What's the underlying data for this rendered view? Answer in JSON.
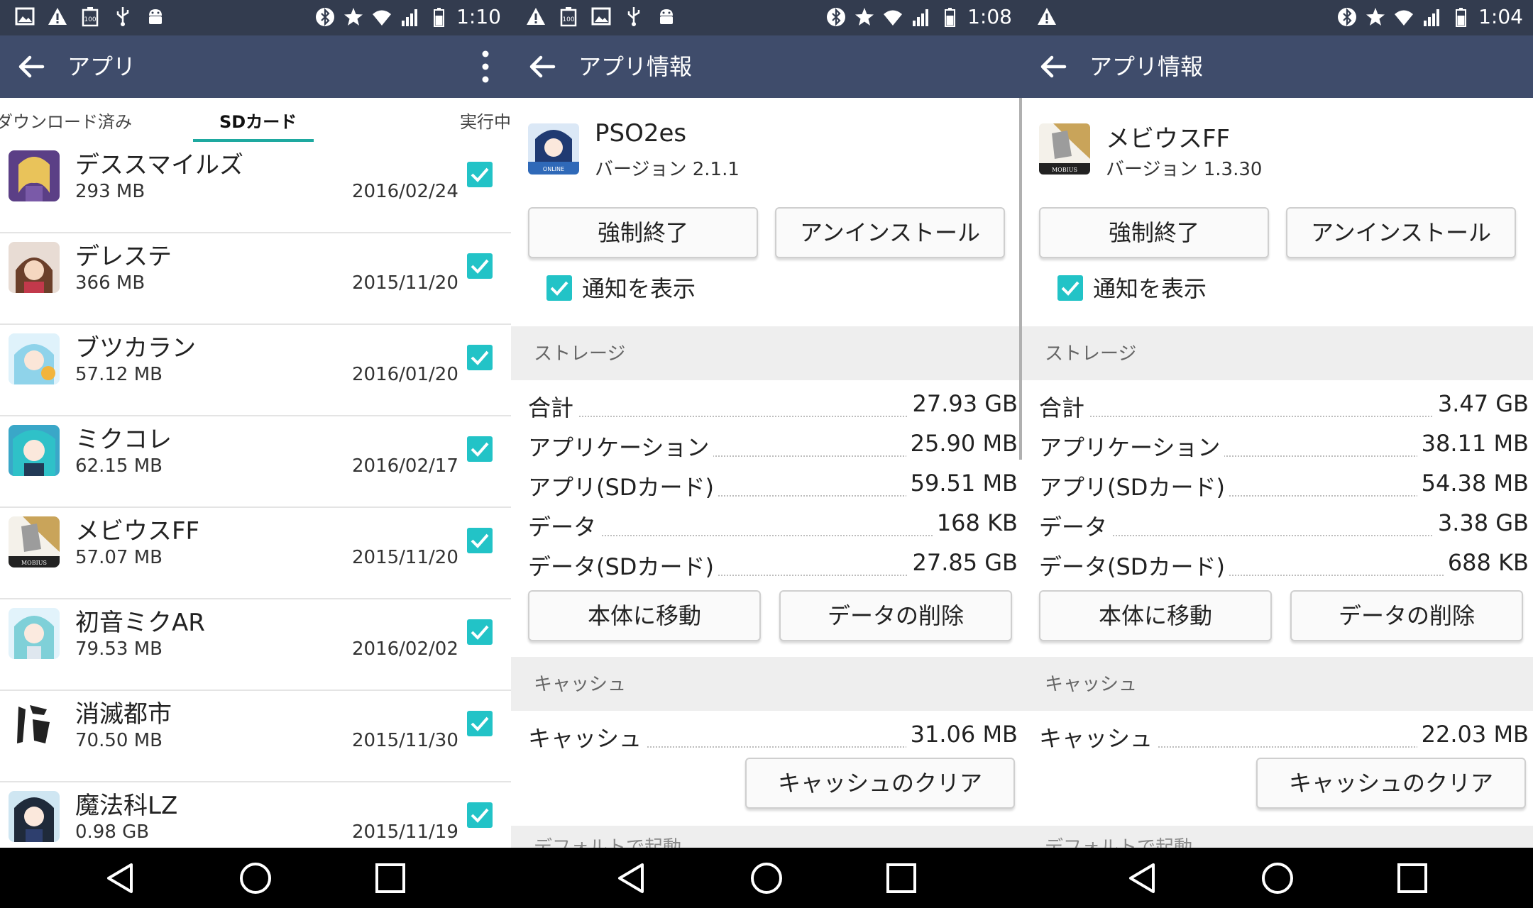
{
  "colors": {
    "status_bar": "#333c4f",
    "app_bar": "#3f4c6b",
    "accent": "#22c3c7",
    "tab_indicator": "#1ea9a0",
    "section_bg": "#eeeeee"
  },
  "panel1": {
    "status": {
      "time": "1:10",
      "icons_left": [
        "image-icon",
        "warning-icon",
        "battery-100-icon",
        "usb-icon",
        "android-icon"
      ],
      "icons_right": [
        "bluetooth-icon",
        "star-icon",
        "wifi-icon",
        "signal-icon",
        "battery-icon"
      ]
    },
    "appbar": {
      "title": "アプリ"
    },
    "tabs": [
      {
        "label": "ダウンロード済み"
      },
      {
        "label": "SDカード"
      },
      {
        "label": "実行中"
      }
    ],
    "apps": [
      {
        "name": "デススマイルズ",
        "size": "293 MB",
        "date": "2016/02/24"
      },
      {
        "name": "デレステ",
        "size": "366 MB",
        "date": "2015/11/20"
      },
      {
        "name": "ブツカラン",
        "size": "57.12 MB",
        "date": "2016/01/20"
      },
      {
        "name": "ミクコレ",
        "size": "62.15 MB",
        "date": "2016/02/17"
      },
      {
        "name": "メビウスFF",
        "size": "57.07 MB",
        "date": "2015/11/20"
      },
      {
        "name": "初音ミクAR",
        "size": "79.53 MB",
        "date": "2016/02/02"
      },
      {
        "name": "消滅都市",
        "size": "70.50 MB",
        "date": "2015/11/30"
      },
      {
        "name": "魔法科LZ",
        "size": "0.98 GB",
        "date": "2015/11/19"
      }
    ]
  },
  "panel2": {
    "status": {
      "time": "1:08"
    },
    "appbar": {
      "title": "アプリ情報"
    },
    "app": {
      "name": "PSO2es",
      "version": "バージョン 2.1.1"
    },
    "buttons": {
      "force_stop": "強制終了",
      "uninstall": "アンインストール",
      "move": "本体に移動",
      "clear_data": "データの削除",
      "clear_cache": "キャッシュのクリア"
    },
    "notify_label": "通知を表示",
    "storage_header": "ストレージ",
    "storage": [
      {
        "label": "合計",
        "value": "27.93 GB"
      },
      {
        "label": "アプリケーション",
        "value": "25.90 MB"
      },
      {
        "label": "アプリ(SDカード)",
        "value": "59.51 MB"
      },
      {
        "label": "データ",
        "value": "168 KB"
      },
      {
        "label": "データ(SDカード)",
        "value": "27.85 GB"
      }
    ],
    "cache_header": "キャッシュ",
    "cache": {
      "label": "キャッシュ",
      "value": "31.06 MB"
    },
    "partial_header": "デフォルトで起動"
  },
  "panel3": {
    "status": {
      "time": "1:04"
    },
    "appbar": {
      "title": "アプリ情報"
    },
    "app": {
      "name": "メビウスFF",
      "version": "バージョン 1.3.30"
    },
    "buttons": {
      "force_stop": "強制終了",
      "uninstall": "アンインストール",
      "move": "本体に移動",
      "clear_data": "データの削除",
      "clear_cache": "キャッシュのクリア"
    },
    "notify_label": "通知を表示",
    "storage_header": "ストレージ",
    "storage": [
      {
        "label": "合計",
        "value": "3.47 GB"
      },
      {
        "label": "アプリケーション",
        "value": "38.11 MB"
      },
      {
        "label": "アプリ(SDカード)",
        "value": "54.38 MB"
      },
      {
        "label": "データ",
        "value": "3.38 GB"
      },
      {
        "label": "データ(SDカード)",
        "value": "688 KB"
      }
    ],
    "cache_header": "キャッシュ",
    "cache": {
      "label": "キャッシュ",
      "value": "22.03 MB"
    },
    "partial_header": "デフォルトで起動"
  }
}
